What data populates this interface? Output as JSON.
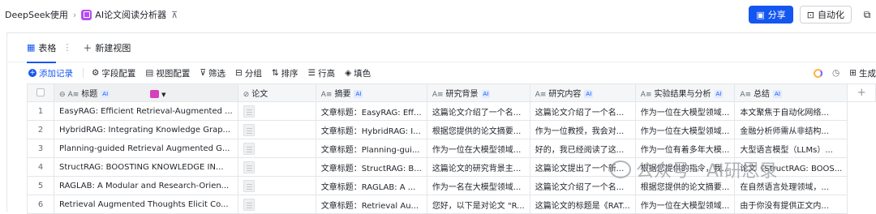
{
  "breadcrumb": {
    "root": "DeepSeek使用",
    "current": "AI论文阅读分析器"
  },
  "header": {
    "share_label": "分享",
    "automation_label": "自动化"
  },
  "tabs": {
    "table_label": "表格",
    "new_view_label": "新建视图"
  },
  "toolbar": {
    "add_record": "添加记录",
    "field_config": "字段配置",
    "view_config": "视图配置",
    "filter": "筛选",
    "group": "分组",
    "sort": "排序",
    "row_height": "行高",
    "fill": "填色",
    "generate": "生成"
  },
  "columns": {
    "title": "标题",
    "paper": "论文",
    "summary": "摘要",
    "background": "研究背景",
    "content": "研究内容",
    "results": "实验结果与分析",
    "conclusion": "总结",
    "ai_badge": "AI"
  },
  "rows": [
    {
      "num": "1",
      "title": "EasyRAG: Efficient Retrieval-Augmented ...",
      "summary": "文章标题：EasyRAG: Eff...",
      "background": "这篇论文介绍了一个名...",
      "content": "这篇论文介绍了一个名...",
      "results": "作为一位在大模型领域...",
      "conclusion": "本文聚焦于自动化网络..."
    },
    {
      "num": "2",
      "title": "HybridRAG: Integrating Knowledge Grap...",
      "summary": "文章标题：HybridRAG: I...",
      "background": "根据您提供的论文摘要...",
      "content": "作为一位教授，我会对...",
      "results": "作为一位在大模型领域...",
      "conclusion": "金融分析师需从非结构..."
    },
    {
      "num": "3",
      "title": "Planning-guided Retrieval Augmented G...",
      "summary": "文章标题：Planning-gui...",
      "background": "作为一位在大模型领域...",
      "content": "好的，我已经阅读了这...",
      "results": "作为一位有着多年大模...",
      "conclusion": "大型语言模型（LLMs）..."
    },
    {
      "num": "4",
      "title": "StructRAG: BOOSTING KNOWLEDGE IN...",
      "summary": "文章标题：StructRAG: B...",
      "background": "这篇论文的研究背景主...",
      "content": "这篇论文提出了一个新...",
      "results": "根据您提供的指令，我...",
      "conclusion": "论文《StructRAG: BOOS..."
    },
    {
      "num": "5",
      "title": "RAGLAB: A Modular and Research-Orien...",
      "summary": "文章标题：RAGLAB: A ...",
      "background": "作为一名在大模型领域...",
      "content": "这篇论文介绍了一个名...",
      "results": "根据您提供的论文摘要...",
      "conclusion": "在自然语言处理领域，..."
    },
    {
      "num": "6",
      "title": "Retrieval Augmented Thoughts Elicit Co...",
      "summary": "文章标题：Retrieval Au...",
      "background": "您好，以下是对论文 \"R...",
      "content": "这篇论文的标题是《RAT...",
      "results": "作为一位在大模型领域...",
      "conclusion": "由于你没有提供正文内..."
    }
  ],
  "watermark": "公众号 · AI研思录",
  "colors": {
    "accent": "#1456f0",
    "app_icon": "#b44cf0",
    "sort_badge": "#d63fbb"
  }
}
